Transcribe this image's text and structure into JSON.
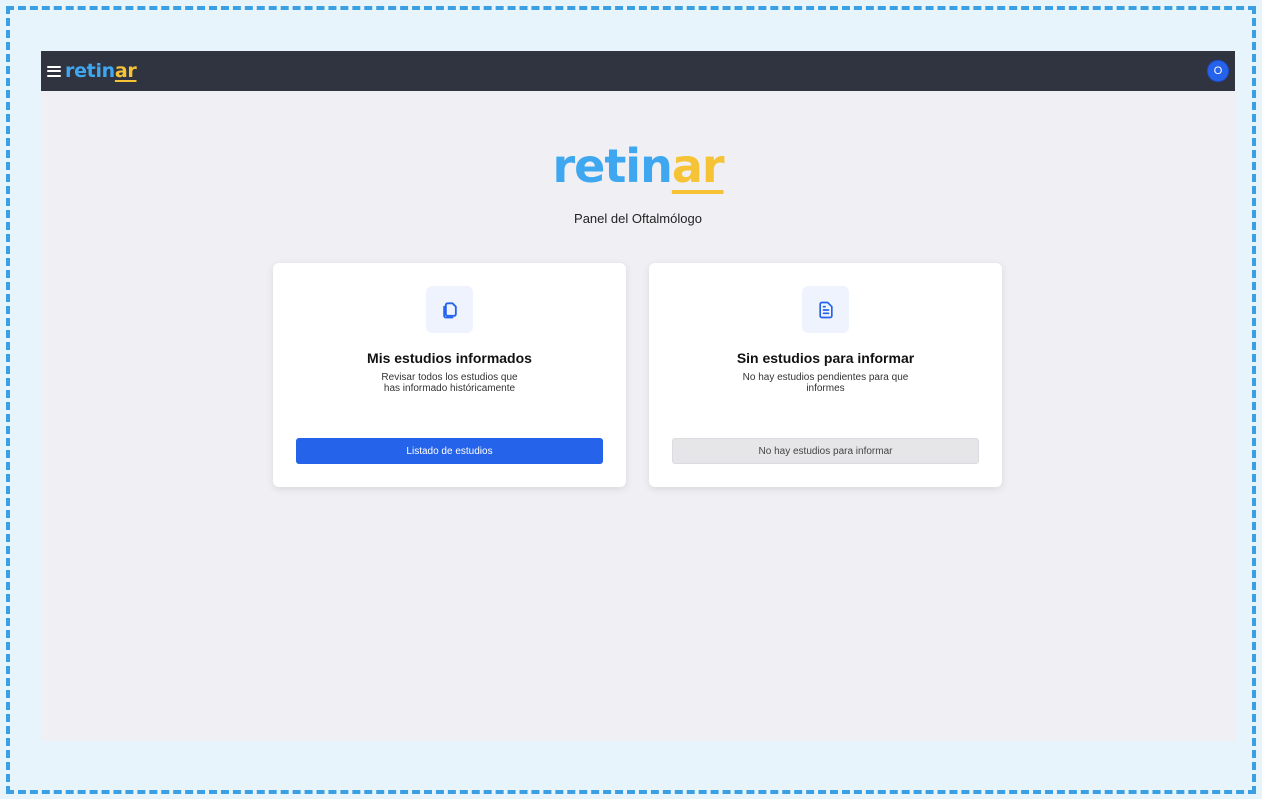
{
  "header": {
    "brand_part1": "retin",
    "brand_part2": "ar",
    "menu_icon": "hamburger-menu-icon",
    "avatar_initial": "O"
  },
  "hero": {
    "brand_part1": "retin",
    "brand_part2": "ar",
    "subtitle": "Panel del Oftalmólogo"
  },
  "cards": [
    {
      "icon": "copy-documents-icon",
      "title": "Mis estudios informados",
      "description": "Revisar todos los estudios que has informado históricamente",
      "button_label": "Listado de estudios",
      "button_enabled": true
    },
    {
      "icon": "document-text-icon",
      "title": "Sin estudios para informar",
      "description": "No hay estudios pendientes para que informes",
      "button_label": "No hay estudios para informar",
      "button_enabled": false
    }
  ],
  "colors": {
    "brand_blue": "#3ea7ef",
    "brand_yellow": "#f5c335",
    "primary": "#2563eb",
    "topbar": "#2f3440"
  }
}
